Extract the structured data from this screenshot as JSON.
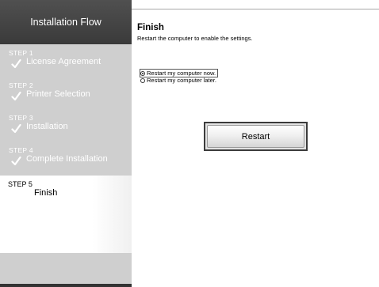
{
  "sidebar": {
    "title": "Installation Flow",
    "steps": [
      {
        "number": "STEP 1",
        "label": "License Agreement",
        "completed": true
      },
      {
        "number": "STEP 2",
        "label": "Printer Selection",
        "completed": true
      },
      {
        "number": "STEP 3",
        "label": "Installation",
        "completed": true
      },
      {
        "number": "STEP 4",
        "label": "Complete Installation",
        "completed": true
      }
    ],
    "active_step": {
      "number": "STEP 5",
      "label": "Finish"
    }
  },
  "main": {
    "title": "Finish",
    "subtitle": "Restart the computer to enable the settings.",
    "options": [
      {
        "label": "Restart my computer now.",
        "selected": true
      },
      {
        "label": "Restart my computer later.",
        "selected": false
      }
    ],
    "restart_button": "Restart"
  },
  "colors": {
    "sidebar_header": "#3f3f3f",
    "sidebar_bg": "#cfcfcf",
    "active_step_bg": "#ffffff"
  },
  "icons": {
    "step_complete": "checkmark-icon"
  }
}
